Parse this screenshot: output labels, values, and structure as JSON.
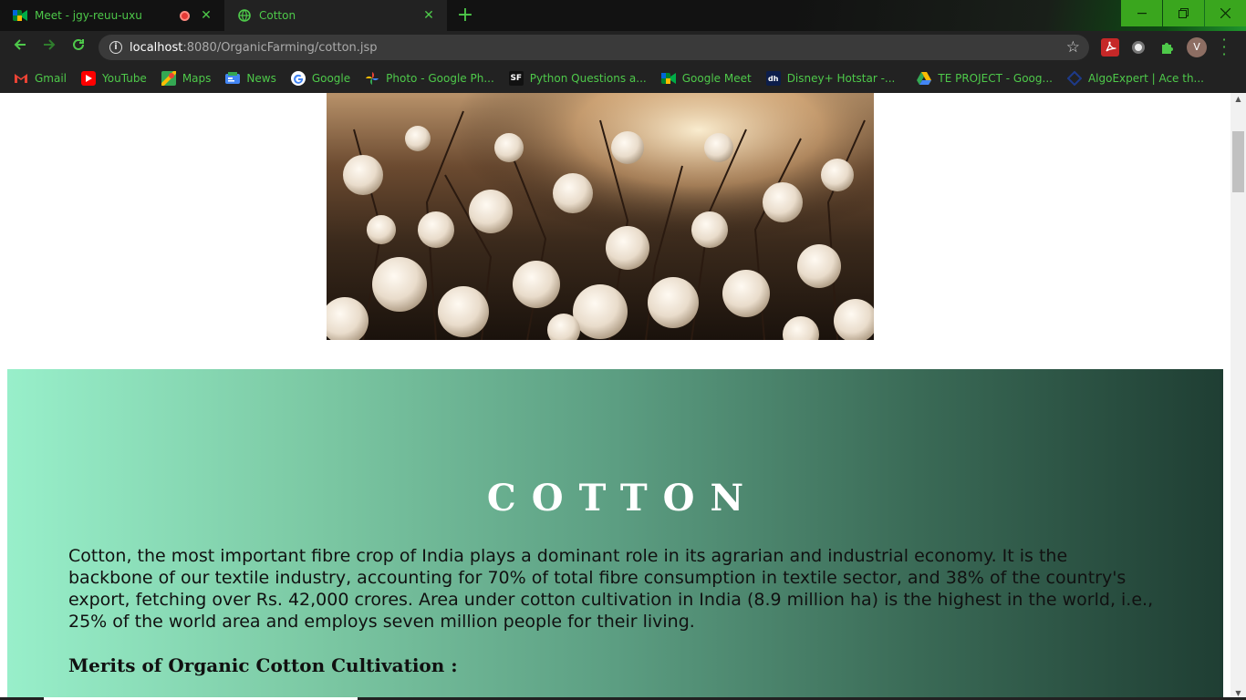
{
  "browser": {
    "tabs": [
      {
        "title": "Meet - jgy-reuu-uxu",
        "recording": true
      },
      {
        "title": "Cotton"
      }
    ],
    "new_tab_label": "+",
    "url_host": "localhost",
    "url_rest": ":8080/OrganicFarming/cotton.jsp",
    "avatar_letter": "V",
    "bookmarks": [
      {
        "label": "Gmail",
        "icon": "gmail-icon"
      },
      {
        "label": "YouTube",
        "icon": "youtube-icon"
      },
      {
        "label": "Maps",
        "icon": "maps-icon"
      },
      {
        "label": "News",
        "icon": "news-icon"
      },
      {
        "label": "Google",
        "icon": "google-icon"
      },
      {
        "label": "Photo - Google Ph...",
        "icon": "photos-icon"
      },
      {
        "label": "Python Questions a...",
        "icon": "sf-icon"
      },
      {
        "label": "Google Meet",
        "icon": "meet-icon"
      },
      {
        "label": "Disney+ Hotstar -...",
        "icon": "hotstar-icon"
      },
      {
        "label": "TE PROJECT - Goog...",
        "icon": "drive-icon"
      },
      {
        "label": "AlgoExpert | Ace th...",
        "icon": "algoexpert-icon"
      }
    ],
    "colors": {
      "accent": "#4ec94a",
      "chrome_bg": "#222222",
      "window_buttons": "#3aa61e"
    }
  },
  "page": {
    "hero_image": "cotton-field-photo",
    "heading": "COTTON",
    "intro": "Cotton, the most important fibre crop of India plays a dominant role in its agrarian and industrial economy. It is the backbone of our textile industry, accounting for 70% of total fibre consumption in textile sector, and 38% of the country's export, fetching over Rs. 42,000 crores. Area under cotton cultivation in India (8.9 million ha) is the highest in the world, i.e., 25% of the world area and employs seven million people for their living.",
    "merits_heading": "Merits of Organic Cotton Cultivation :",
    "colors": {
      "gradient_start": "#98efca",
      "gradient_end": "#1f3e33"
    }
  }
}
